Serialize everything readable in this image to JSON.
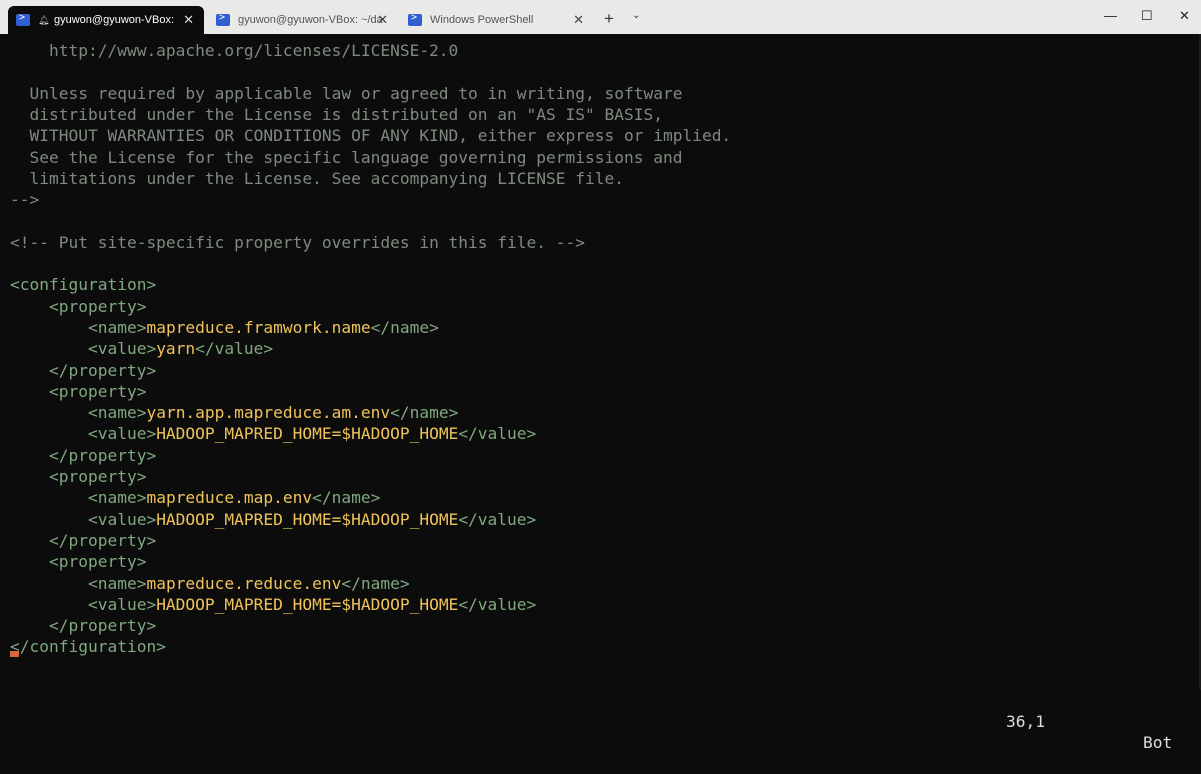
{
  "tabs": [
    {
      "label": "gyuwon@gyuwon-VBox:",
      "active": true
    },
    {
      "label": "gyuwon@gyuwon-VBox: ~/da",
      "active": false
    },
    {
      "label": "Windows PowerShell",
      "active": false
    }
  ],
  "window": {
    "minimize": "—",
    "maximize": "☐",
    "close": "✕",
    "new_tab": "+",
    "dropdown": "⌄"
  },
  "lines": [
    {
      "parts": [
        {
          "c": "c",
          "t": "    http://www.apache.org/licenses/LICENSE-2.0"
        }
      ]
    },
    {
      "parts": [
        {
          "c": "c",
          "t": ""
        }
      ]
    },
    {
      "parts": [
        {
          "c": "c",
          "t": "  Unless required by applicable law or agreed to in writing, software"
        }
      ]
    },
    {
      "parts": [
        {
          "c": "c",
          "t": "  distributed under the License is distributed on an \"AS IS\" BASIS,"
        }
      ]
    },
    {
      "parts": [
        {
          "c": "c",
          "t": "  WITHOUT WARRANTIES OR CONDITIONS OF ANY KIND, either express or implied."
        }
      ]
    },
    {
      "parts": [
        {
          "c": "c",
          "t": "  See the License for the specific language governing permissions and"
        }
      ]
    },
    {
      "parts": [
        {
          "c": "c",
          "t": "  limitations under the License. See accompanying LICENSE file."
        }
      ]
    },
    {
      "parts": [
        {
          "c": "c",
          "t": "-->"
        }
      ]
    },
    {
      "parts": [
        {
          "c": "c",
          "t": ""
        }
      ]
    },
    {
      "parts": [
        {
          "c": "c",
          "t": "<!-- Put site-specific property overrides in this file. -->"
        }
      ]
    },
    {
      "parts": [
        {
          "c": "c",
          "t": ""
        }
      ]
    },
    {
      "parts": [
        {
          "c": "t",
          "t": "<configuration>"
        }
      ]
    },
    {
      "parts": [
        {
          "c": "t",
          "t": "    <property>"
        }
      ]
    },
    {
      "parts": [
        {
          "c": "t",
          "t": "        <name>"
        },
        {
          "c": "y",
          "t": "mapreduce.framwork.name"
        },
        {
          "c": "t",
          "t": "</name>"
        }
      ]
    },
    {
      "parts": [
        {
          "c": "t",
          "t": "        <value>"
        },
        {
          "c": "y",
          "t": "yarn"
        },
        {
          "c": "t",
          "t": "</value>"
        }
      ]
    },
    {
      "parts": [
        {
          "c": "t",
          "t": "    </property>"
        }
      ]
    },
    {
      "parts": [
        {
          "c": "t",
          "t": "    <property>"
        }
      ]
    },
    {
      "parts": [
        {
          "c": "t",
          "t": "        <name>"
        },
        {
          "c": "y",
          "t": "yarn.app.mapreduce.am.env"
        },
        {
          "c": "t",
          "t": "</name>"
        }
      ]
    },
    {
      "parts": [
        {
          "c": "t",
          "t": "        <value>"
        },
        {
          "c": "y",
          "t": "HADOOP_MAPRED_HOME=$HADOOP_HOME"
        },
        {
          "c": "t",
          "t": "</value>"
        }
      ]
    },
    {
      "parts": [
        {
          "c": "t",
          "t": "    </property>"
        }
      ]
    },
    {
      "parts": [
        {
          "c": "t",
          "t": "    <property>"
        }
      ]
    },
    {
      "parts": [
        {
          "c": "t",
          "t": "        <name>"
        },
        {
          "c": "y",
          "t": "mapreduce.map.env"
        },
        {
          "c": "t",
          "t": "</name>"
        }
      ]
    },
    {
      "parts": [
        {
          "c": "t",
          "t": "        <value>"
        },
        {
          "c": "y",
          "t": "HADOOP_MAPRED_HOME=$HADOOP_HOME"
        },
        {
          "c": "t",
          "t": "</value>"
        }
      ]
    },
    {
      "parts": [
        {
          "c": "t",
          "t": "    </property>"
        }
      ]
    },
    {
      "parts": [
        {
          "c": "t",
          "t": "    <property>"
        }
      ]
    },
    {
      "parts": [
        {
          "c": "t",
          "t": "        <name>"
        },
        {
          "c": "y",
          "t": "mapreduce.reduce.env"
        },
        {
          "c": "t",
          "t": "</name>"
        }
      ]
    },
    {
      "parts": [
        {
          "c": "t",
          "t": "        <value>"
        },
        {
          "c": "y",
          "t": "HADOOP_MAPRED_HOME=$HADOOP_HOME"
        },
        {
          "c": "t",
          "t": "</value>"
        }
      ]
    },
    {
      "parts": [
        {
          "c": "t",
          "t": "    </property>"
        }
      ]
    },
    {
      "parts": [
        {
          "c": "t",
          "t": "</configuration>"
        }
      ]
    }
  ],
  "status": {
    "position": "36,1",
    "scroll": "Bot"
  },
  "colors": {
    "comment": "#7f8a7f",
    "tag": "#7fa87f",
    "value": "#efc35a",
    "background": "#0c0c0c",
    "cursor": "#d9673c"
  }
}
